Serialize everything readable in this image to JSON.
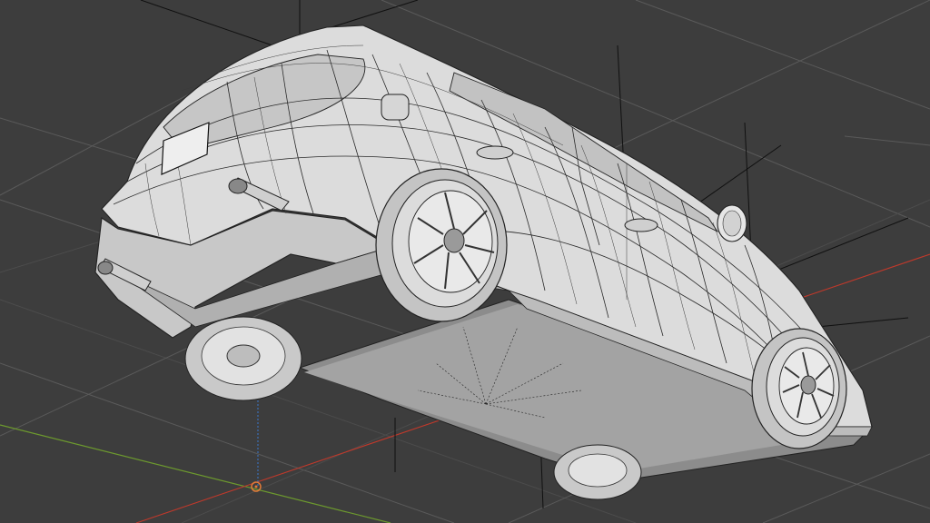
{
  "viewport": {
    "mode": "3d-wireframe-shaded",
    "background_color": "#3d3d3d",
    "grid_color": "#5a5a5a",
    "x_axis_color": "#c0392b",
    "y_axis_color": "#6d9a2e",
    "z_axis_color": "#3b6fb5",
    "object_fill_color": "#d8d8d8",
    "wire_color": "#2a2a2a",
    "origin_marker_color": "#e07b39"
  },
  "object": {
    "name_icon": "car-model-icon",
    "parts": [
      "body",
      "rear-wheel-left",
      "rear-wheel-right",
      "front-wheel-left",
      "front-wheel-right",
      "side-mirror",
      "exhaust-left",
      "exhaust-right",
      "license-plate",
      "underbody"
    ]
  }
}
